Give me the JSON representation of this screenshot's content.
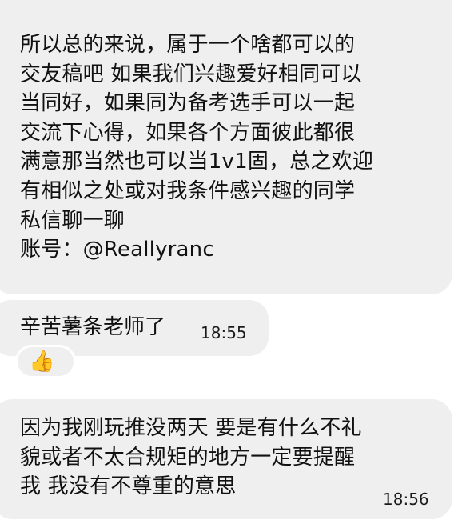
{
  "messages": [
    {
      "text": "所以总的来说，属于一个啥都可以的\n交友稿吧 如果我们兴趣爱好相同可以\n当同好，如果同为备考选手可以一起\n交流下心得，如果各个方面彼此都很\n满意那当然也可以当1v1固，总之欢迎\n有相似之处或对我条件感兴趣的同学\n私信聊一聊\n账号：@Reallyranc"
    },
    {
      "text": "辛苦薯条老师了",
      "time": "18:55",
      "reaction": "👍"
    },
    {
      "text": "因为我刚玩推没两天 要是有什么不礼\n貌或者不太合规矩的地方一定要提醒\n我 我没有不尊重的意思",
      "time": "18:56"
    }
  ],
  "colors": {
    "bubble_bg": "#efefef",
    "page_bg": "#ffffff",
    "text": "#111111"
  }
}
